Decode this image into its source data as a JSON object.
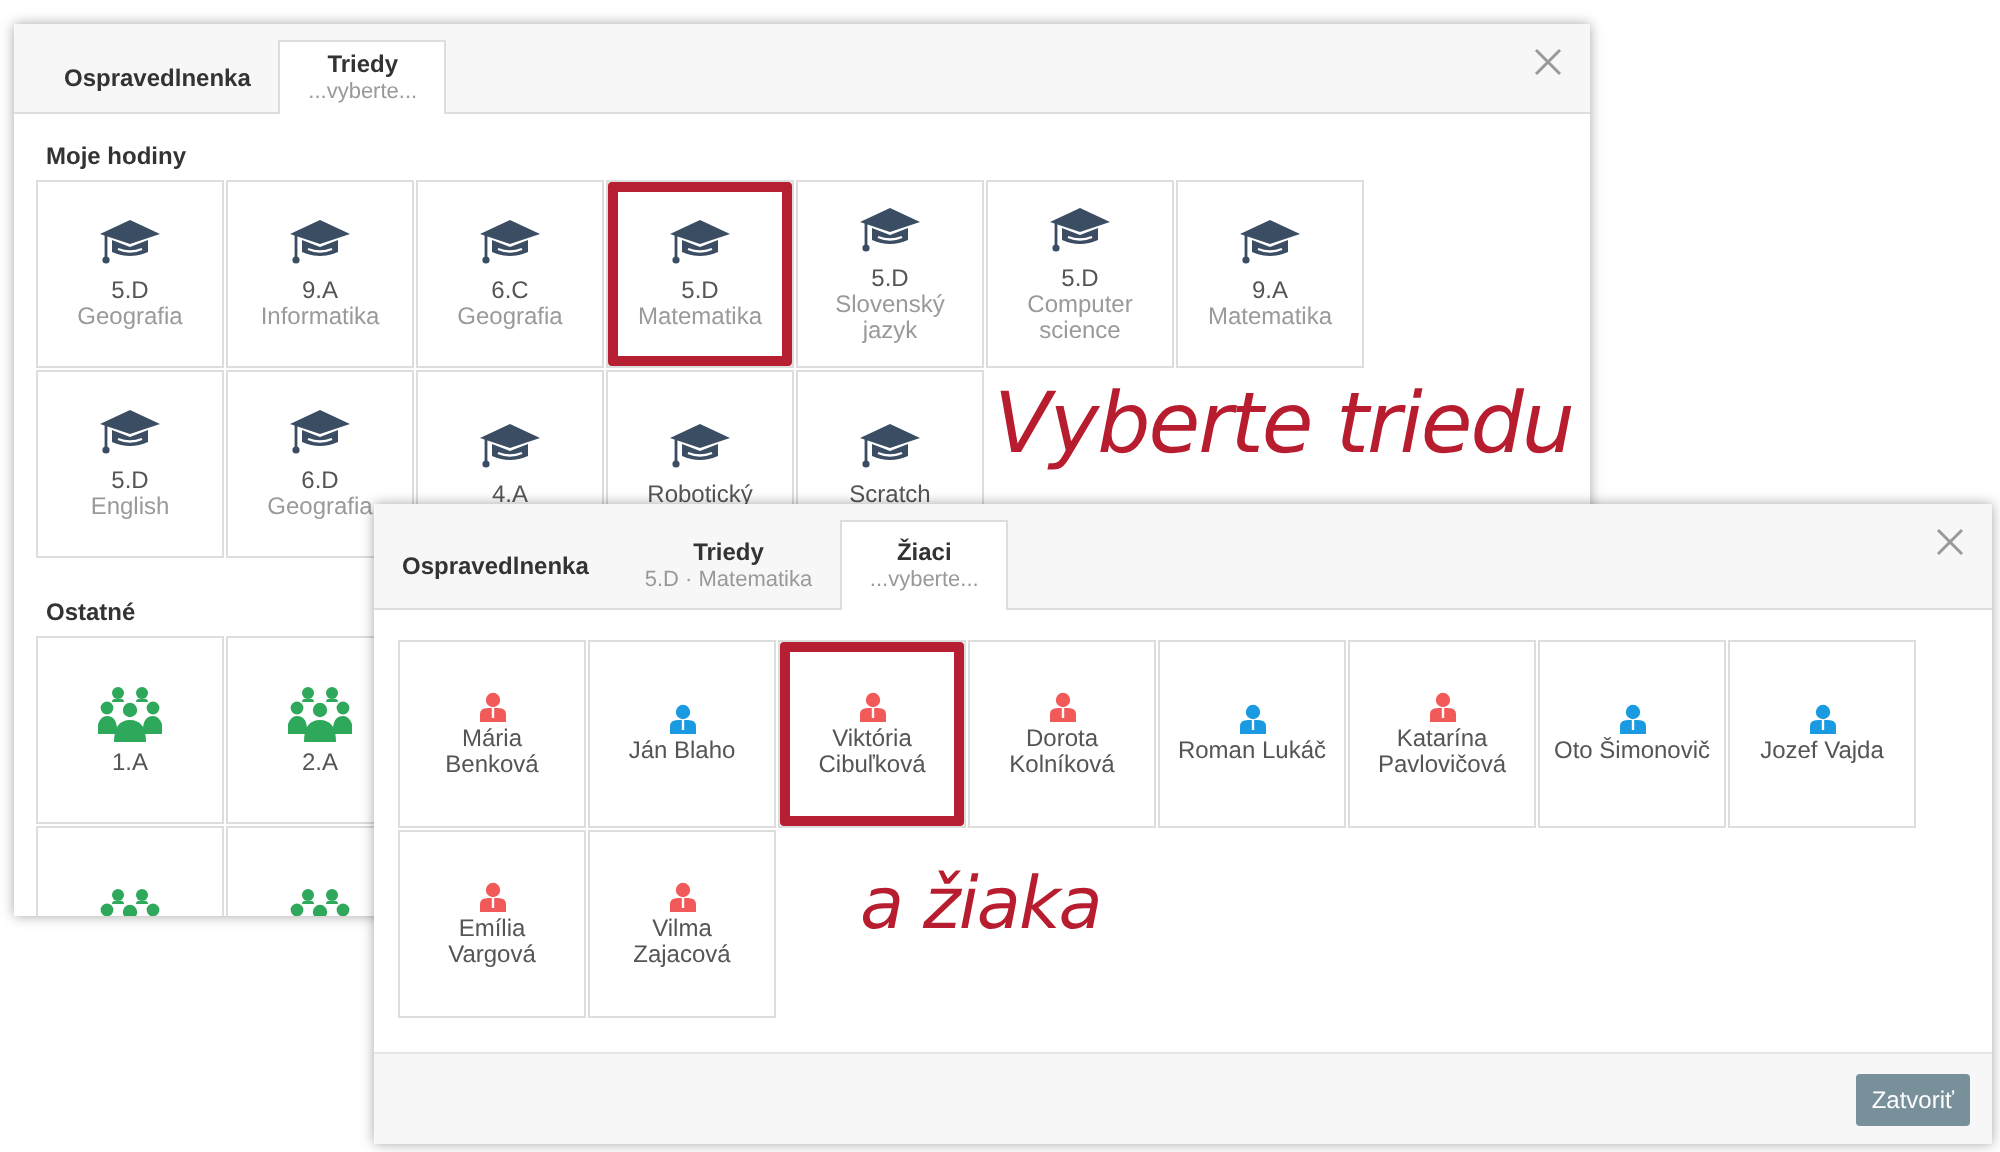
{
  "windows": [
    {
      "tabs": [
        {
          "label": "Ospravedlnenka",
          "selected": false
        },
        {
          "label": "Triedy",
          "sublabel": "...vyberte...",
          "selected": true
        }
      ],
      "sections": [
        {
          "title": "Moje hodiny",
          "tiles": [
            {
              "kind": "cap",
              "lines": [
                "5.D",
                "Geografia"
              ]
            },
            {
              "kind": "cap",
              "lines": [
                "9.A",
                "Informatika"
              ]
            },
            {
              "kind": "cap",
              "lines": [
                "6.C",
                "Geografia"
              ]
            },
            {
              "kind": "cap",
              "lines": [
                "5.D",
                "Matematika"
              ]
            },
            {
              "kind": "cap",
              "lines": [
                "5.D",
                "Slovenský",
                "jazyk"
              ]
            },
            {
              "kind": "cap",
              "lines": [
                "5.D",
                "Computer",
                "science"
              ]
            },
            {
              "kind": "cap",
              "lines": [
                "9.A",
                "Matematika"
              ]
            },
            {
              "kind": "cap",
              "lines": [
                "5.D",
                "English"
              ]
            },
            {
              "kind": "cap",
              "lines": [
                "6.D",
                "Geografia"
              ]
            },
            {
              "kind": "cap",
              "lines": [
                "4.A"
              ]
            },
            {
              "kind": "cap",
              "lines": [
                "Robotický"
              ]
            },
            {
              "kind": "cap",
              "lines": [
                "Scratch"
              ]
            }
          ]
        },
        {
          "title": "Ostatné",
          "tiles": [
            {
              "kind": "group",
              "lines": [
                "1.A"
              ]
            },
            {
              "kind": "group",
              "lines": [
                "2.A"
              ]
            },
            {
              "kind": "group"
            },
            {
              "kind": "group"
            }
          ]
        }
      ]
    },
    {
      "tabs": [
        {
          "label": "Ospravedlnenka",
          "selected": false
        },
        {
          "label": "Triedy",
          "sublabel": "5.D · Matematika",
          "selected": false
        },
        {
          "label": "Žiaci",
          "sublabel": "...vyberte...",
          "selected": true
        }
      ],
      "sections": [
        {
          "tiles": [
            {
              "kind": "person",
              "color": "#f25a5a",
              "lines": [
                "Mária",
                "Benková"
              ]
            },
            {
              "kind": "person",
              "color": "#1a9ae0",
              "lines": [
                "Ján Blaho"
              ]
            },
            {
              "kind": "person",
              "color": "#f25a5a",
              "lines": [
                "Viktória",
                "Cibuľková"
              ]
            },
            {
              "kind": "person",
              "color": "#f25a5a",
              "lines": [
                "Dorota",
                "Kolníková"
              ]
            },
            {
              "kind": "person",
              "color": "#1a9ae0",
              "lines": [
                "Roman Lukáč"
              ]
            },
            {
              "kind": "person",
              "color": "#f25a5a",
              "lines": [
                "Katarína",
                "Pavlovičová"
              ]
            },
            {
              "kind": "person",
              "color": "#1a9ae0",
              "lines": [
                "Oto Šimonovič"
              ]
            },
            {
              "kind": "person",
              "color": "#1a9ae0",
              "lines": [
                "Jozef Vajda"
              ]
            },
            {
              "kind": "person",
              "color": "#f25a5a",
              "lines": [
                "Emília",
                "Vargová"
              ]
            },
            {
              "kind": "person",
              "color": "#f25a5a",
              "lines": [
                "Vilma",
                "Zajacová"
              ]
            }
          ]
        }
      ],
      "footer": {
        "button": "Zatvoriť"
      }
    }
  ],
  "annotations": [
    {
      "kind": "frame"
    },
    {
      "kind": "text",
      "text": "Vyberte triedu"
    },
    {
      "kind": "frame"
    },
    {
      "kind": "text",
      "text": "a žiaka"
    }
  ]
}
